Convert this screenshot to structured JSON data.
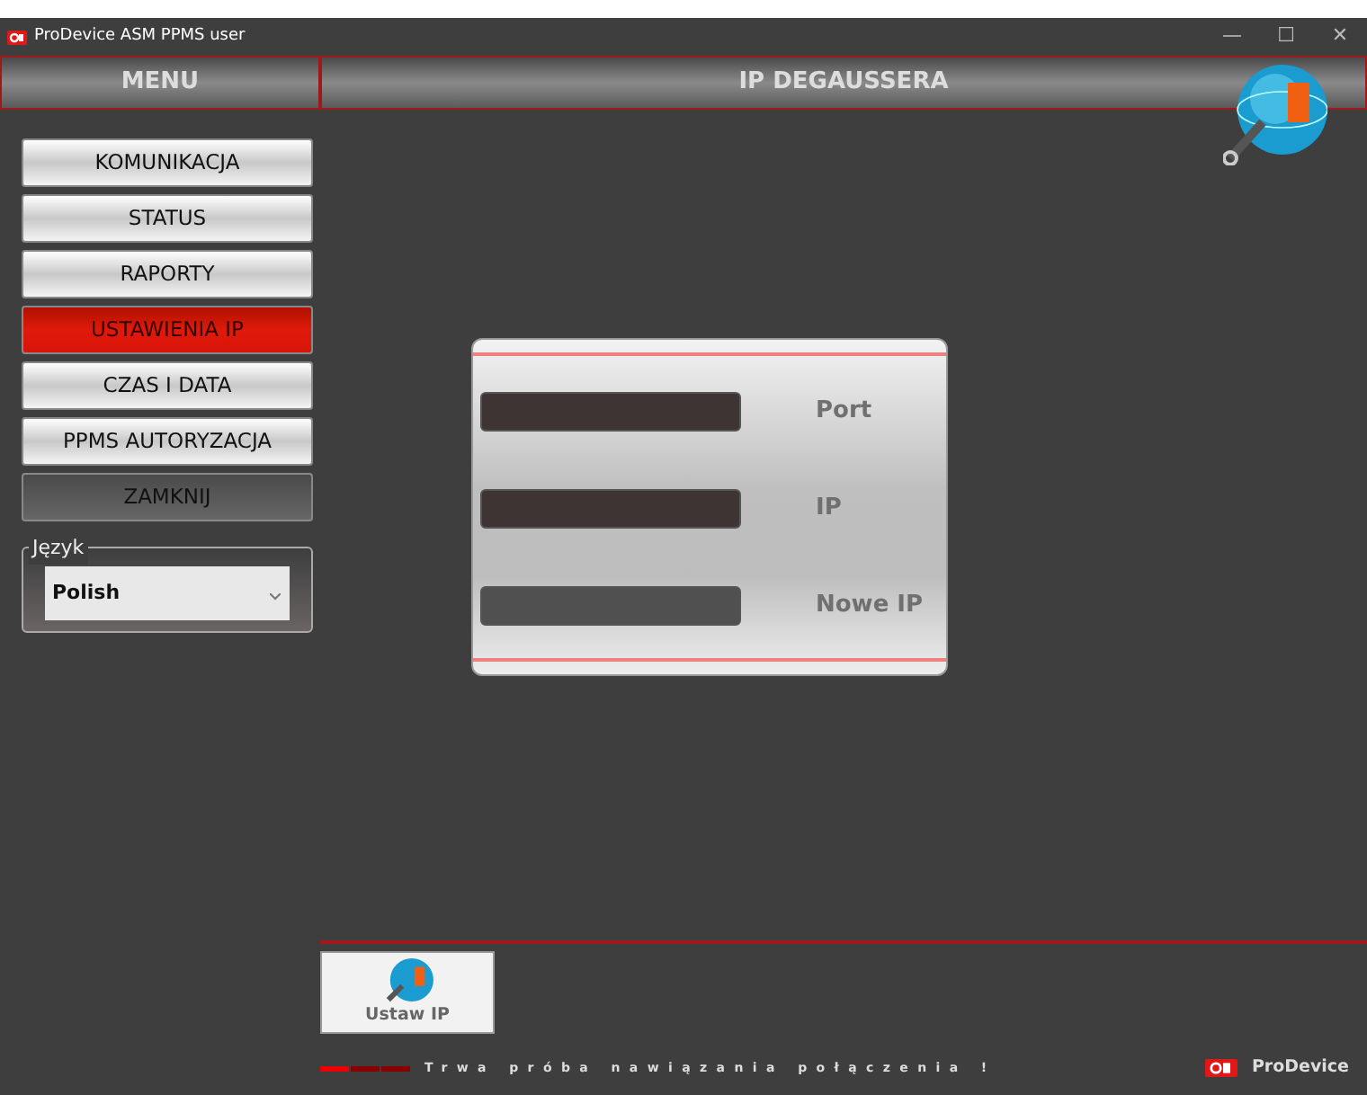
{
  "window": {
    "title": "ProDevice ASM PPMS user",
    "controls": [
      "—",
      "☐",
      "✕"
    ]
  },
  "sidebar": {
    "header": "MENU",
    "items": [
      {
        "label": "KOMUNIKACJA",
        "kind": "nav",
        "selected": false
      },
      {
        "label": "STATUS",
        "kind": "nav",
        "selected": false
      },
      {
        "label": "RAPORTY",
        "kind": "nav",
        "selected": false
      },
      {
        "label": "USTAWIENIA IP",
        "kind": "nav",
        "selected": true
      },
      {
        "label": "CZAS I DATA",
        "kind": "nav",
        "selected": false
      },
      {
        "label": "PPMS AUTORYZACJA",
        "kind": "nav",
        "selected": false
      },
      {
        "label": "ZAMKNIJ",
        "kind": "exit",
        "selected": false
      }
    ],
    "language": {
      "legend": "Język",
      "value": "Polish"
    }
  },
  "main": {
    "header": "IP DEGAUSSERA",
    "fields": [
      {
        "label": "Port",
        "readonly": true
      },
      {
        "label": "IP",
        "readonly": true
      },
      {
        "label": "Nowe IP",
        "readonly": false
      }
    ]
  },
  "toolbar": {
    "buttons": [
      "Ustaw IP"
    ]
  },
  "status_bar": {
    "message": "Trwa próba nawiązania połączenia !",
    "brand": "ProDevice"
  }
}
